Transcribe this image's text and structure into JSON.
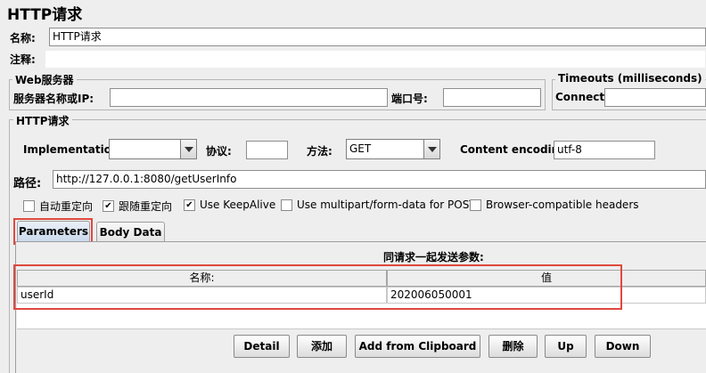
{
  "title": "HTTP请求",
  "name_label": "名称:",
  "name_value": "HTTP请求",
  "comment_label": "注释:",
  "web_server": {
    "group_title": "Web服务器",
    "server_label": "服务器名称或IP:",
    "server_value": "",
    "port_label": "端口号:",
    "port_value": ""
  },
  "timeouts": {
    "group_title": "Timeouts (milliseconds)",
    "connect_label": "Connect:",
    "connect_value": ""
  },
  "http_request": {
    "group_title": "HTTP请求",
    "implementation_label": "Implementation:",
    "implementation_value": "",
    "protocol_label": "协议:",
    "protocol_value": "",
    "method_label": "方法:",
    "method_value": "GET",
    "encoding_label": "Content encoding:",
    "encoding_value": "utf-8",
    "path_label": "路径:",
    "path_value": "http://127.0.0.1:8080/getUserInfo"
  },
  "options": [
    {
      "label": "自动重定向",
      "checked": false
    },
    {
      "label": "跟随重定向",
      "checked": true
    },
    {
      "label": "Use KeepAlive",
      "checked": true
    },
    {
      "label": "Use multipart/form-data for POST",
      "checked": false
    },
    {
      "label": "Browser-compatible headers",
      "checked": false
    }
  ],
  "tabs": [
    {
      "label": "Parameters",
      "active": true
    },
    {
      "label": "Body Data",
      "active": false
    }
  ],
  "params": {
    "caption": "同请求一起发送参数:",
    "columns": [
      "名称:",
      "值"
    ],
    "rows": [
      {
        "name": "userId",
        "value": "202006050001"
      }
    ]
  },
  "buttons": {
    "detail": "Detail",
    "add": "添加",
    "add_clipboard": "Add from Clipboard",
    "delete": "删除",
    "up": "Up",
    "down": "Down"
  },
  "colors": {
    "highlight": "#e0483e",
    "background": "#eeeeee"
  }
}
